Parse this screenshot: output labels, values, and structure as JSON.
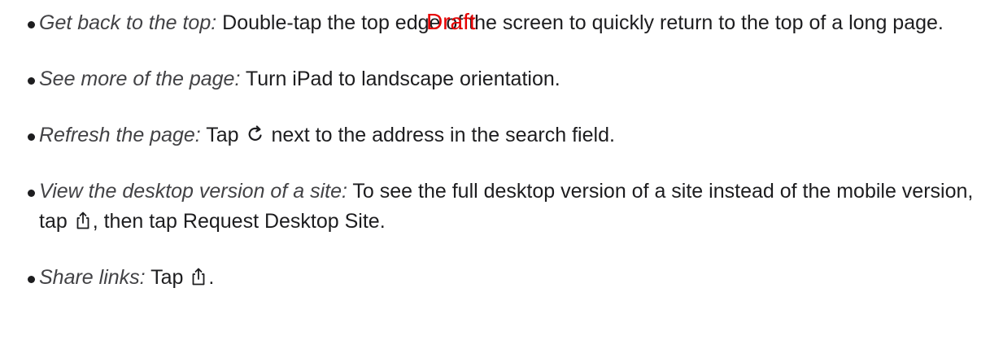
{
  "watermark": {
    "text": "Draft",
    "color": "#e60000"
  },
  "tips": [
    {
      "lead": "Get back to the top:",
      "text_before": " Double-tap the top edge of the screen to quickly return to the top of a long page.",
      "icon": null,
      "text_after": ""
    },
    {
      "lead": "See more of the page:",
      "text_before": " Turn iPad to landscape orientation.",
      "icon": null,
      "text_after": ""
    },
    {
      "lead": "Refresh the page:",
      "text_before": " Tap ",
      "icon": "refresh-icon",
      "text_after": " next to the address in the search field."
    },
    {
      "lead": "View the desktop version of a site:",
      "text_before": " To see the full desktop version of a site instead of the mobile version, tap ",
      "icon": "share-icon",
      "text_after": ", then tap Request Desktop Site."
    },
    {
      "lead": "Share links:",
      "text_before": " Tap ",
      "icon": "share-icon",
      "text_after": "."
    }
  ]
}
